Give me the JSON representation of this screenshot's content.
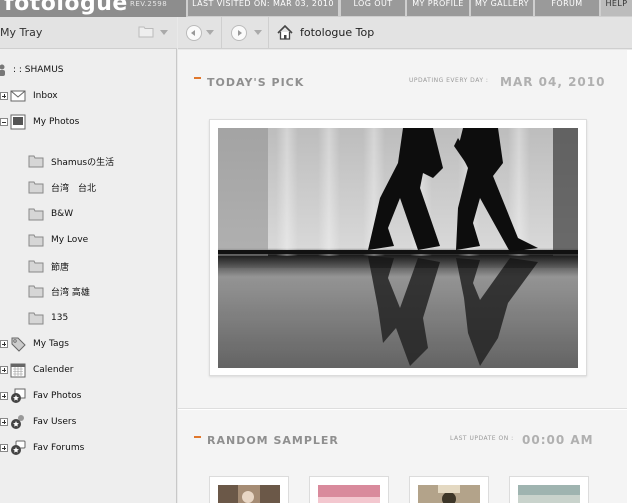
{
  "app": {
    "logo_text": "fotologue",
    "version": "REV.2598"
  },
  "nav": [
    {
      "label": "LAST VISITED ON: MAR 03, 2010"
    },
    {
      "label": "LOG OUT"
    },
    {
      "label": "MY PROFILE"
    },
    {
      "label": "MY GALLERY"
    },
    {
      "label": "FORUM"
    },
    {
      "label": "HELP"
    }
  ],
  "tray": {
    "title": "My Tray",
    "user": ": : SHAMUS",
    "items": [
      {
        "label": "Inbox",
        "icon": "inbox-icon",
        "expander": "plus"
      },
      {
        "label": "My Photos",
        "icon": "photos-icon",
        "expander": "minus"
      },
      {
        "label": "Shamusの生活",
        "icon": "folder-icon"
      },
      {
        "label": "台湾　台北",
        "icon": "folder-icon"
      },
      {
        "label": "B&W",
        "icon": "folder-icon"
      },
      {
        "label": "My Love",
        "icon": "folder-icon"
      },
      {
        "label": "節唐",
        "icon": "folder-icon"
      },
      {
        "label": "台湾 高雄",
        "icon": "folder-icon"
      },
      {
        "label": "135",
        "icon": "folder-icon"
      },
      {
        "label": "My Tags",
        "icon": "tag-icon",
        "expander": "plus"
      },
      {
        "label": "Calender",
        "icon": "calendar-icon",
        "expander": "plus"
      },
      {
        "label": "Fav Photos",
        "icon": "fav-photos-icon",
        "expander": "plus"
      },
      {
        "label": "Fav Users",
        "icon": "fav-users-icon",
        "expander": "plus"
      },
      {
        "label": "Fav Forums",
        "icon": "fav-forums-icon",
        "expander": "plus"
      }
    ]
  },
  "navbar": {
    "breadcrumb": "fotologue Top"
  },
  "todays_pick": {
    "title": "TODAY'S PICK",
    "updating_label": "UPDATING EVERY DAY :",
    "date": "MAR 04, 2010"
  },
  "random_sampler": {
    "title": "RANDOM SAMPLER",
    "last_update_label": "LAST UPDATE ON :",
    "time": "00:00 AM"
  },
  "colors": {
    "accent": "#e0772c",
    "header": "#9a9a9a"
  }
}
